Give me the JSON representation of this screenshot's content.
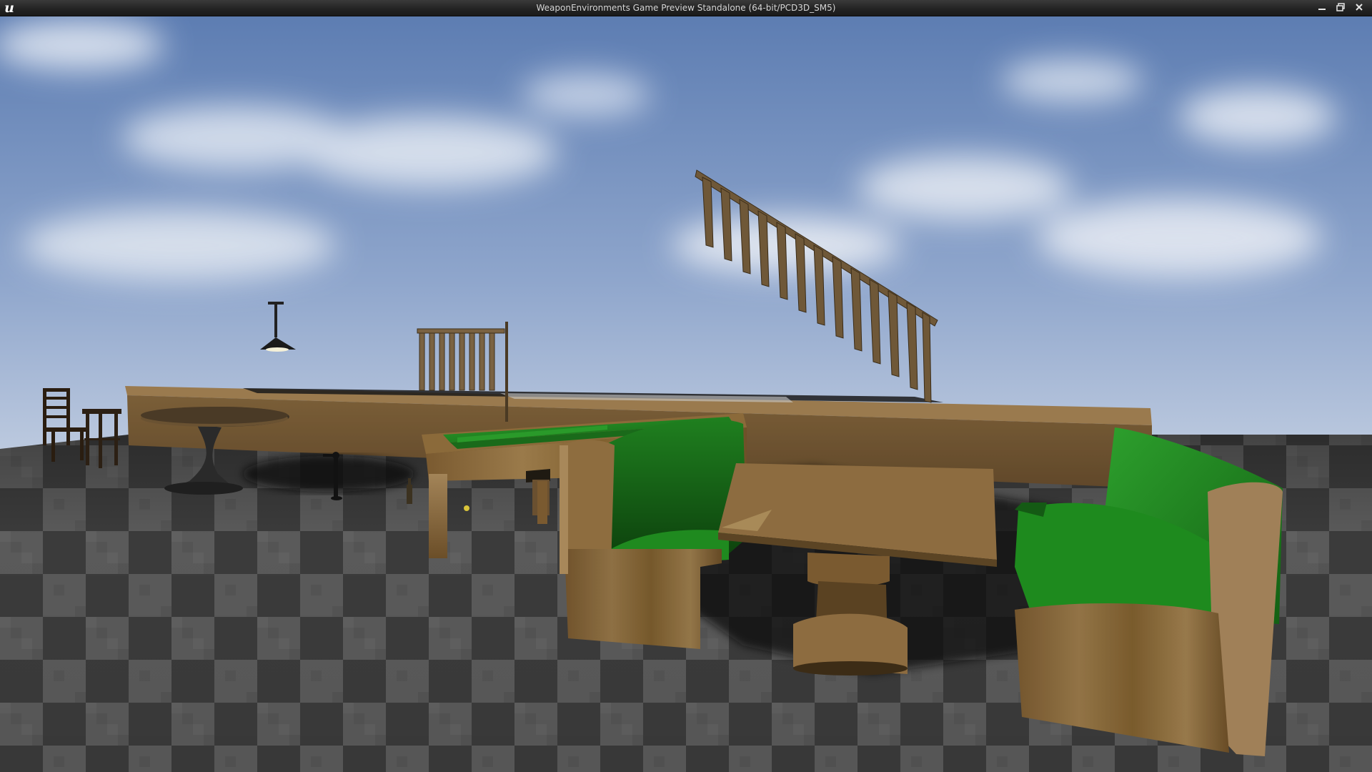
{
  "window": {
    "title": "WeaponEnvironments Game Preview Standalone (64-bit/PCD3D_SM5)",
    "logo_icon": "unreal-engine-logo-icon",
    "controls": [
      {
        "name": "minimize-button",
        "icon": "minimize-icon"
      },
      {
        "name": "restore-button",
        "icon": "restore-icon"
      },
      {
        "name": "close-button",
        "icon": "close-icon"
      }
    ]
  },
  "scene": {
    "objects": [
      "sky",
      "checkered-floor",
      "bar-counter",
      "staircase-railing",
      "railing-segment",
      "hanging-lamp",
      "round-table",
      "wooden-chair",
      "bar-stool",
      "pool-table",
      "cue-stick",
      "booth-seat-left",
      "booth-table",
      "booth-seat-right",
      "bottle",
      "standing-figure"
    ]
  },
  "colors": {
    "sky_top": "#5f7fb3",
    "sky_bottom": "#e9edf3",
    "floor_dark": "#3a3a3a",
    "floor_light": "#565656",
    "wood": "#8a6a3e",
    "felt": "#1e7d1e"
  }
}
